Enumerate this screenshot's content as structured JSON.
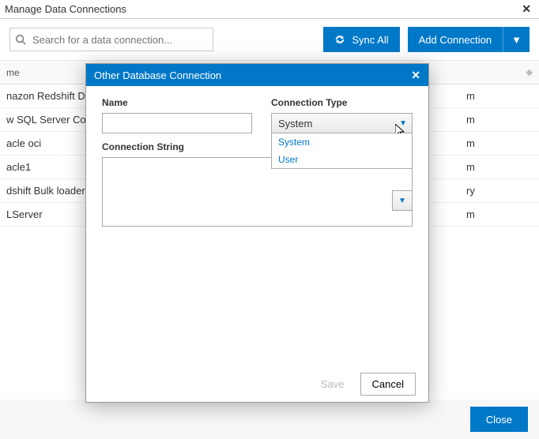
{
  "colors": {
    "accent": "#0078c8"
  },
  "titlebar": {
    "title": "Manage Data Connections",
    "close_glyph": "✕"
  },
  "toolbar": {
    "search_placeholder": "Search for a data connection...",
    "sync_label": "Sync All",
    "add_label": "Add Connection",
    "chevron_glyph": "▼"
  },
  "header": {
    "name_col": "me",
    "sort_glyph": "◆"
  },
  "rows": [
    {
      "name": "nazon Redshift DSN",
      "right": "m"
    },
    {
      "name": "w SQL Server Conn",
      "right": "m"
    },
    {
      "name": "acle oci",
      "right": "m"
    },
    {
      "name": "acle1",
      "right": "m"
    },
    {
      "name": "dshift Bulk loader",
      "right": "ry"
    },
    {
      "name": "LServer",
      "right": "m"
    }
  ],
  "footer": {
    "close_label": "Close"
  },
  "modal": {
    "title": "Other Database Connection",
    "close_glyph": "✕",
    "name_label": "Name",
    "name_value": "",
    "conn_type_label": "Connection Type",
    "conn_type_selected": "System",
    "conn_type_options": [
      "System",
      "User"
    ],
    "conn_string_label": "Connection String",
    "conn_string_value": "",
    "save_label": "Save",
    "cancel_label": "Cancel",
    "tri_glyph": "▼"
  }
}
